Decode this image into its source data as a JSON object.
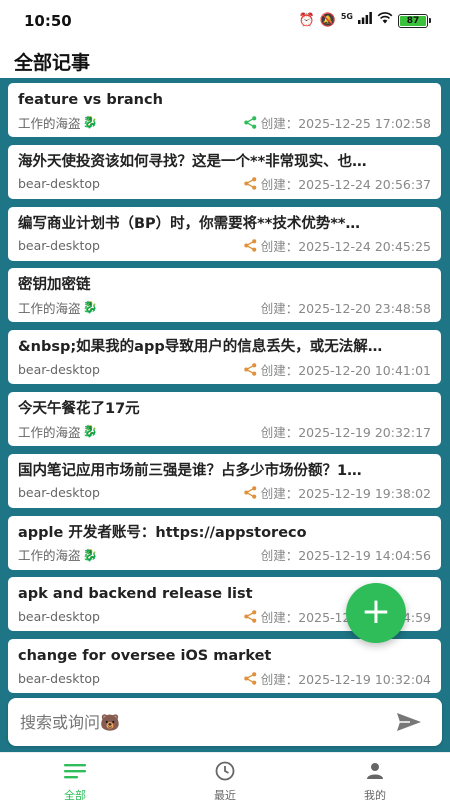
{
  "status": {
    "time": "10:50",
    "network": "5G",
    "battery": "87"
  },
  "header": {
    "title": "全部记事"
  },
  "notes": [
    {
      "title": "feature vs branch",
      "source": "工作的海盗",
      "dragon": true,
      "shared": true,
      "share_color": "#2ebd59",
      "created": "创建：2025-12-25 17:02:58"
    },
    {
      "title": "海外天使投资该如何寻找？这是一个**非常现实、也…",
      "source": "bear-desktop",
      "dragon": false,
      "shared": true,
      "share_color": "#e0913a",
      "created": "创建：2025-12-24 20:56:37"
    },
    {
      "title": "编写商业计划书（BP）时，你需要将**技术优势**…",
      "source": "bear-desktop",
      "dragon": false,
      "shared": true,
      "share_color": "#e0913a",
      "created": "创建：2025-12-24 20:45:25"
    },
    {
      "title": "密钥加密链",
      "source": "工作的海盗",
      "dragon": true,
      "shared": false,
      "share_color": "",
      "created": "创建：2025-12-20 23:48:58"
    },
    {
      "title": "&nbsp;如果我的app导致用户的信息丢失，或无法解…",
      "source": "bear-desktop",
      "dragon": false,
      "shared": true,
      "share_color": "#e0913a",
      "created": "创建：2025-12-20 10:41:01"
    },
    {
      "title": "今天午餐花了17元",
      "source": "工作的海盗",
      "dragon": true,
      "shared": false,
      "share_color": "",
      "created": "创建：2025-12-19 20:32:17"
    },
    {
      "title": "国内笔记应用市场前三强是谁？占多少市场份额？1…",
      "source": "bear-desktop",
      "dragon": false,
      "shared": true,
      "share_color": "#e0913a",
      "created": "创建：2025-12-19 19:38:02"
    },
    {
      "title": "apple 开发者账号：https://appstoreco",
      "source": "工作的海盗",
      "dragon": true,
      "shared": false,
      "share_color": "",
      "created": "创建：2025-12-19 14:04:56"
    },
    {
      "title": "apk and backend release list",
      "source": "bear-desktop",
      "dragon": false,
      "shared": true,
      "share_color": "#e0913a",
      "created": "创建：2025-12-19 10:34:59"
    },
    {
      "title": "change for oversee iOS market",
      "source": "bear-desktop",
      "dragon": false,
      "shared": true,
      "share_color": "#e0913a",
      "created": "创建：2025-12-19 10:32:04"
    }
  ],
  "search": {
    "placeholder": "搜索或询问🐻"
  },
  "fab": {
    "label": "+"
  },
  "tabs": [
    {
      "label": "全部",
      "active": true
    },
    {
      "label": "最近",
      "active": false
    },
    {
      "label": "我的",
      "active": false
    }
  ],
  "colors": {
    "accent": "#2ebd59",
    "list_bg": "#1e7585",
    "share_orange": "#e0913a"
  }
}
